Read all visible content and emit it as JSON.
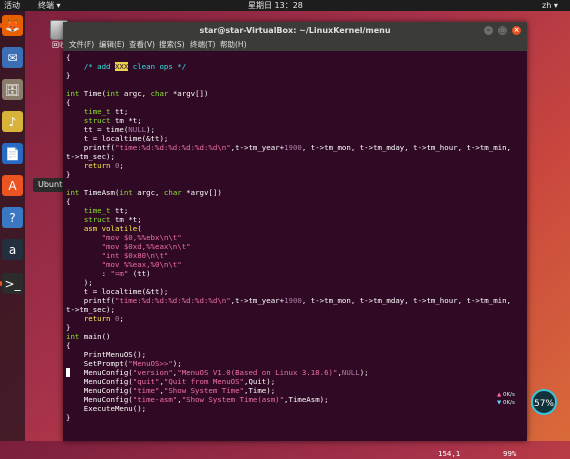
{
  "topbar": {
    "activities": "活动",
    "app_menu": "终端 ▾",
    "clock": "星期日 13：28",
    "input_method": "zh ▾"
  },
  "tooltip": "Ubuntu 软件",
  "desktop": {
    "trash_label": "回收"
  },
  "dock": [
    {
      "name": "firefox-icon",
      "glyph": "🦊"
    },
    {
      "name": "thunderbird-icon",
      "glyph": "✉"
    },
    {
      "name": "files-icon",
      "glyph": "🗄"
    },
    {
      "name": "rhythmbox-icon",
      "glyph": "♪"
    },
    {
      "name": "libreoffice-writer-icon",
      "glyph": "📄"
    },
    {
      "name": "ubuntu-software-icon",
      "glyph": "A"
    },
    {
      "name": "help-icon",
      "glyph": "?"
    },
    {
      "name": "amazon-icon",
      "glyph": "a"
    },
    {
      "name": "terminal-icon",
      "glyph": ">_"
    }
  ],
  "window": {
    "title": "star@star-VirtualBox: ~/LinuxKernel/menu",
    "menus": [
      "文件(F)",
      "编辑(E)",
      "查看(V)",
      "搜索(S)",
      "终端(T)",
      "帮助(H)"
    ]
  },
  "code_lines": [
    "{",
    "    /* add XXX clean ops */",
    "}",
    "",
    "int Time(int argc, char *argv[])",
    "{",
    "    time_t tt;",
    "    struct tm *t;",
    "    tt = time(NULL);",
    "    t = localtime(&tt);",
    "    printf(\"time:%d:%d:%d:%d:%d:%d\\n\",t->tm_year+1900, t->tm_mon, t->tm_mday, t->tm_hour, t->tm_min,",
    "t->tm_sec);",
    "    return 0;",
    "}",
    "",
    "int TimeAsm(int argc, char *argv[])",
    "{",
    "    time_t tt;",
    "    struct tm *t;",
    "    asm volatile(",
    "        \"mov $0,%%ebx\\n\\t\"",
    "        \"mov $0xd,%%eax\\n\\t\"",
    "        \"int $0x80\\n\\t\"",
    "        \"mov %%eax,%0\\n\\t\"",
    "        : \"=m\" (tt)",
    "    );",
    "    t = localtime(&tt);",
    "    printf(\"time:%d:%d:%d:%d:%d:%d\\n\",t->tm_year+1900, t->tm_mon, t->tm_mday, t->tm_hour, t->tm_min,",
    "t->tm_sec);",
    "    return 0;",
    "}",
    "int main()",
    "{",
    "    PrintMenuOS();",
    "    SetPrompt(\"MenuOS>>\");",
    "    MenuConfig(\"version\",\"MenuOS V1.0(Based on Linux 3.18.6)\",NULL);",
    "    MenuConfig(\"quit\",\"Quit from MenuOS\",Quit);",
    "    MenuConfig(\"time\",\"Show System Time\",Time);",
    "    MenuConfig(\"time-asm\",\"Show System Time(asm)\",TimeAsm);",
    "    ExecuteMenu();",
    "}"
  ],
  "status": {
    "position": "154,1",
    "scroll": "99%"
  },
  "net_widget": {
    "up": "0K/s",
    "down": "0K/s",
    "percent": "57%"
  }
}
